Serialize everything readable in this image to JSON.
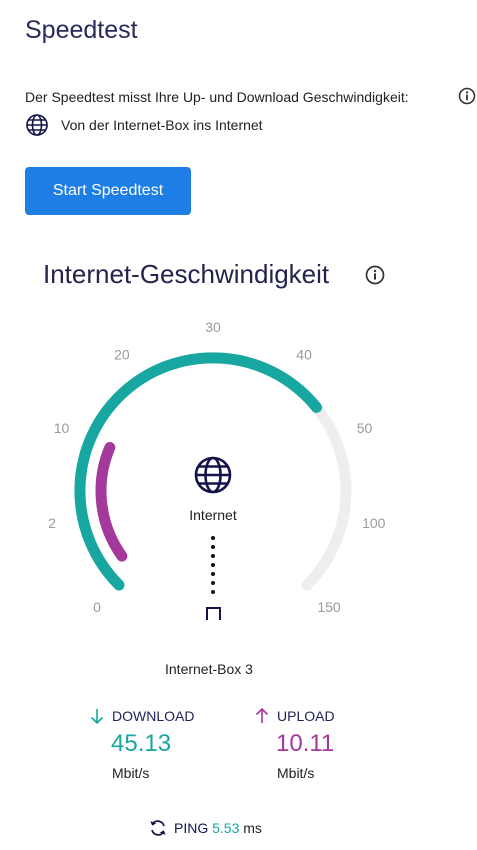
{
  "page": {
    "title": "Speedtest",
    "description": "Der Speedtest misst Ihre Up- und Download Geschwindigkeit:",
    "direction": "Von der Internet-Box ins Internet",
    "start_button": "Start Speedtest"
  },
  "gauge": {
    "heading": "Internet-Geschwindigkeit",
    "scale_labels": [
      "0",
      "2",
      "10",
      "20",
      "30",
      "40",
      "50",
      "100",
      "150"
    ],
    "download_level_label": "45.13",
    "upload_level_label": "10.11",
    "node_internet": "Internet",
    "node_box": "Internet-Box 3"
  },
  "results": {
    "download": {
      "label": "DOWNLOAD",
      "value": "45.13",
      "unit": "Mbit/s"
    },
    "upload": {
      "label": "UPLOAD",
      "value": "10.11",
      "unit": "Mbit/s"
    },
    "ping": {
      "label": "PING",
      "value": "5.53",
      "unit": "ms"
    }
  },
  "colors": {
    "download": "#17a6a0",
    "upload": "#a3399a",
    "track": "#eeeeee",
    "button": "#1f7ee5",
    "navy": "#13134a"
  }
}
